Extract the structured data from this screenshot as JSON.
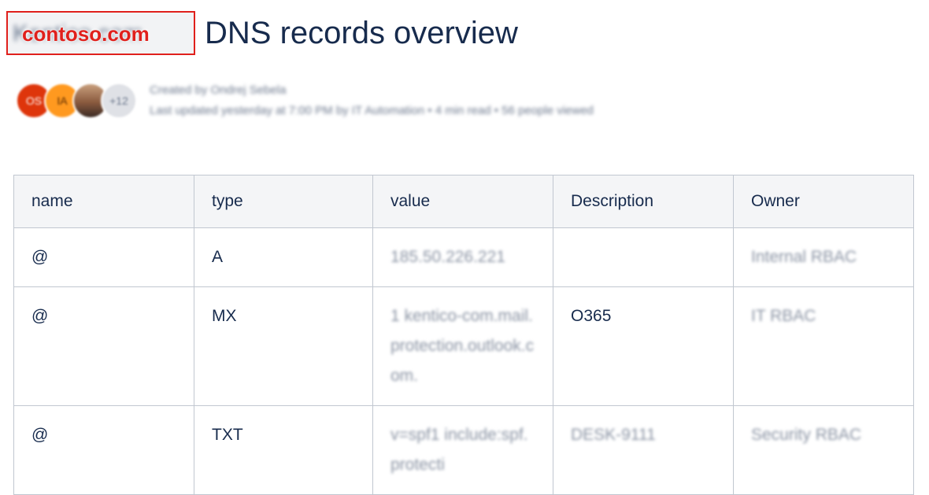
{
  "header": {
    "redaction_label": "contoso.com",
    "redacted_text": "Kentico.com",
    "title": "DNS records overview"
  },
  "byline": {
    "avatars": [
      {
        "initials": "OS",
        "color": "#de350b"
      },
      {
        "initials": "IA",
        "color": "#ff991f"
      },
      {
        "initials": "",
        "color": "#8a5a3e"
      },
      {
        "initials": "+12",
        "color": "#dfe1e6"
      }
    ],
    "created_by": "Created by Ondrej Sebela",
    "last_updated": "Last updated yesterday at 7:00 PM by IT Automation  •  4 min read  •  56 people viewed"
  },
  "table": {
    "columns": [
      "name",
      "type",
      "value",
      "Description",
      "Owner"
    ],
    "rows": [
      {
        "name": "@",
        "type": "A",
        "value": "185.50.226.221",
        "description": "",
        "owner": "Internal RBAC"
      },
      {
        "name": "@",
        "type": "MX",
        "value": "1 kentico-com.mail.protection.outlook.com.",
        "description": "O365",
        "owner": "IT RBAC"
      },
      {
        "name": "@",
        "type": "TXT",
        "value": "v=spf1 include:spf.protecti",
        "description": "DESK-9111",
        "owner": "Security RBAC"
      }
    ]
  }
}
